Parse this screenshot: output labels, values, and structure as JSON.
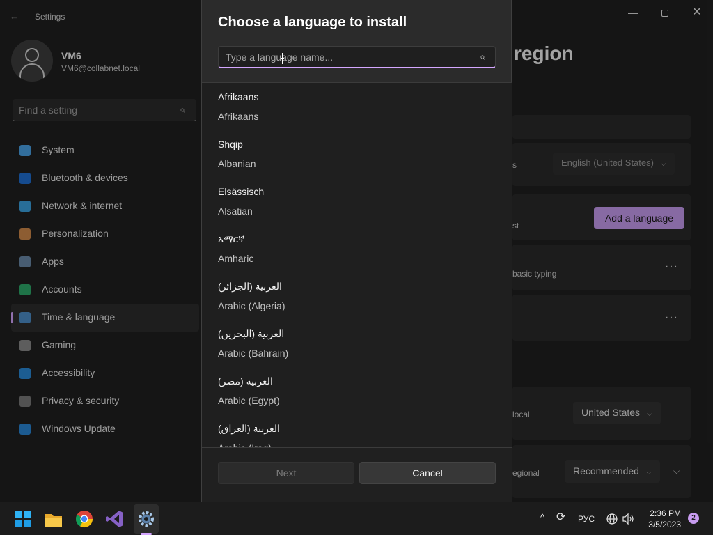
{
  "window": {
    "app_title": "Settings",
    "back_glyph": "←",
    "minimize_glyph": "—",
    "close_glyph": "✕"
  },
  "profile": {
    "name": "VM6",
    "email": "VM6@collabnet.local"
  },
  "search": {
    "placeholder": "Find a setting"
  },
  "nav": {
    "items": [
      {
        "label": "System",
        "icon": "monitor-icon",
        "color": "#4ba3e6"
      },
      {
        "label": "Bluetooth & devices",
        "icon": "bluetooth-icon",
        "color": "#1f6fd1"
      },
      {
        "label": "Network & internet",
        "icon": "wifi-icon",
        "color": "#3ba3e0"
      },
      {
        "label": "Personalization",
        "icon": "brush-icon",
        "color": "#d08a4a"
      },
      {
        "label": "Apps",
        "icon": "apps-icon",
        "color": "#6a8aa8"
      },
      {
        "label": "Accounts",
        "icon": "person-icon",
        "color": "#2eaa6a"
      },
      {
        "label": "Time & language",
        "icon": "globe-clock-icon",
        "color": "#4d8ec9"
      },
      {
        "label": "Gaming",
        "icon": "gamepad-icon",
        "color": "#8a8a8a"
      },
      {
        "label": "Accessibility",
        "icon": "accessibility-icon",
        "color": "#2a8ad8"
      },
      {
        "label": "Privacy & security",
        "icon": "shield-icon",
        "color": "#7a7a7a"
      },
      {
        "label": "Windows Update",
        "icon": "update-icon",
        "color": "#2a86d6"
      }
    ],
    "selected_index": 6
  },
  "background_page": {
    "title_fragment": "region",
    "windows_display_language": "English (United States)",
    "add_language_label": "Add a language",
    "text_fragments": {
      "display_suffix": "s",
      "list_suffix": "st",
      "typing": "basic typing",
      "local": "local",
      "regional": "egional"
    },
    "country": "United States",
    "regional_format": "Recommended",
    "more_glyph": "···",
    "dropdown_chevron": "⌵"
  },
  "dialog": {
    "title": "Choose a language to install",
    "search_placeholder": "Type a language name...",
    "search_icon": "search-icon",
    "languages": [
      {
        "native": "Afrikaans",
        "english": "Afrikaans"
      },
      {
        "native": "Shqip",
        "english": "Albanian"
      },
      {
        "native": "Elsässisch",
        "english": "Alsatian"
      },
      {
        "native": "አማርኛ",
        "english": "Amharic"
      },
      {
        "native": "العربية (الجزائر)",
        "english": "Arabic (Algeria)"
      },
      {
        "native": "العربية (البحرين)",
        "english": "Arabic (Bahrain)"
      },
      {
        "native": "العربية (مصر)",
        "english": "Arabic (Egypt)"
      },
      {
        "native": "العربية (العراق)",
        "english": "Arabic (Iraq)"
      }
    ],
    "next_label": "Next",
    "cancel_label": "Cancel"
  },
  "taskbar": {
    "apps": [
      "start-icon",
      "file-explorer-icon",
      "chrome-icon",
      "visual-studio-icon",
      "settings-icon"
    ],
    "tray_chevron": "^",
    "keyboard_layout": "РУС",
    "time": "2:36 PM",
    "date": "3/5/2023",
    "notification_count": "2"
  }
}
